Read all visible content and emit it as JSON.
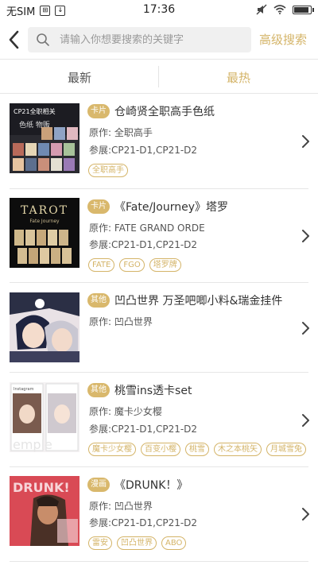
{
  "status": {
    "carrier": "无SIM",
    "time": "17:36"
  },
  "header": {
    "search_placeholder": "请输入你想要搜索的关键字",
    "advanced_label": "高级搜索"
  },
  "tabs": [
    {
      "label": "最新"
    },
    {
      "label": "最热"
    }
  ],
  "colors": {
    "accent": "#d4b468",
    "tag_bg": "#d9b86c"
  },
  "items": [
    {
      "tag": "卡片",
      "title": "仓崎贤全职高手色纸",
      "original": "原作: 全职高手",
      "expo": "参展:CP21-D1,CP21-D2",
      "chips": [
        "全职高手"
      ],
      "thumb_text": "CP21全职相关"
    },
    {
      "tag": "卡片",
      "title": "《Fate/Journey》塔罗",
      "original": "原作: FATE GRAND ORDE",
      "expo": "参展:CP21-D1,CP21-D2",
      "chips": [
        "FATE",
        "FGO",
        "塔罗牌"
      ],
      "thumb_text": "TAROT"
    },
    {
      "tag": "其他",
      "title": "凹凸世界 万圣吧唧小料&瑞金挂件",
      "original": "原作: 凹凸世界",
      "expo": "",
      "chips": []
    },
    {
      "tag": "其他",
      "title": "桃雪ins透卡set",
      "original": "原作: 魔卡少女樱",
      "expo": "参展:CP21-D1,CP21-D2",
      "chips": [
        "魔卡少女樱",
        "百变小樱",
        "桃雪",
        "木之本桃矢",
        "月城雪兔"
      ],
      "thumb_text": "Instagram"
    },
    {
      "tag": "漫画",
      "title": "《DRUNK！》",
      "original": "原作: 凹凸世界",
      "expo": "参展:CP21-D1,CP21-D2",
      "chips": [
        "雷安",
        "凹凸世界",
        "ABO"
      ],
      "thumb_text": "DRUNK!"
    }
  ]
}
